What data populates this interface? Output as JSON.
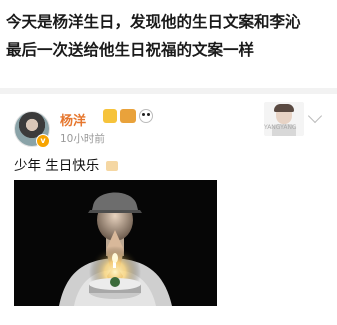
{
  "headline": {
    "line1": "今天是杨洋生日，发现他的生日文案和李沁",
    "line2": "最后一次送给他生日祝福的文案一样"
  },
  "post": {
    "username": "杨洋",
    "timestamp": "10小时前",
    "text": "少年 生日快乐",
    "right_image_watermark": "YANGYANG"
  },
  "icons": {
    "verified": "verified-badge-icon",
    "crown": "crown-badge-icon",
    "vip": "vip-badge-icon",
    "panda": "panda-emoji-icon",
    "cake": "cake-emoji-icon",
    "chevron": "chevron-down-icon"
  },
  "colors": {
    "username": "#e6772e",
    "verified_badge": "#f7a400",
    "timestamp": "#999999"
  }
}
